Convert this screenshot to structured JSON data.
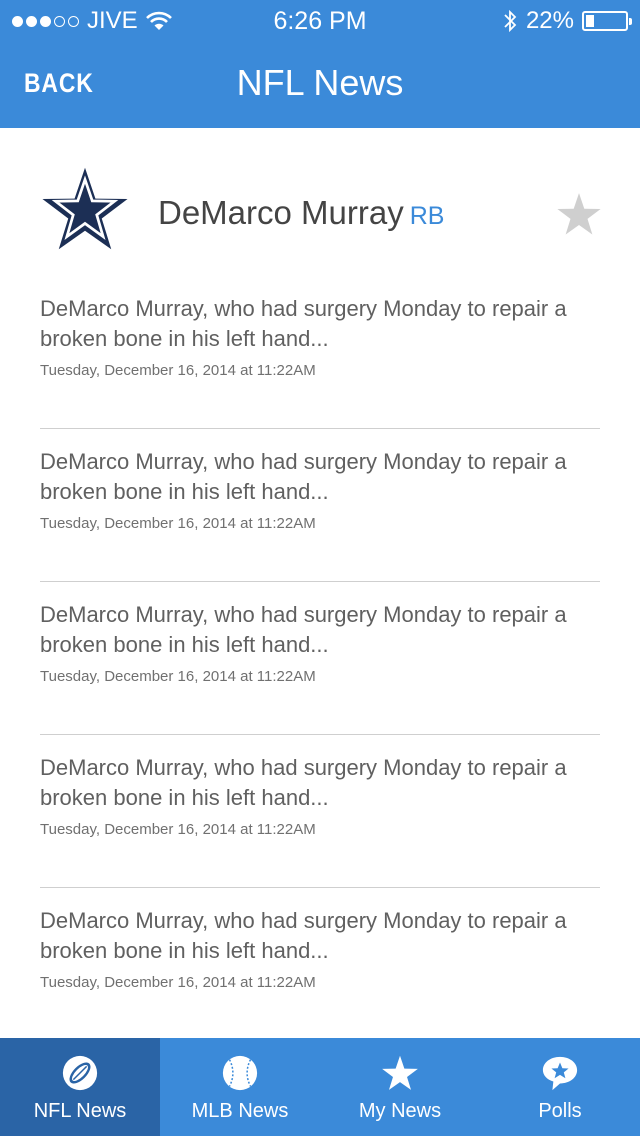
{
  "status_bar": {
    "carrier": "JIVE",
    "time": "6:26 PM",
    "battery": "22%",
    "battery_level": 0.22
  },
  "nav": {
    "back_label": "BACK",
    "title": "NFL News"
  },
  "player": {
    "name": "DeMarco Murray",
    "position": "RB",
    "team_icon": "cowboys-star-icon"
  },
  "news": [
    {
      "text": "DeMarco Murray, who had surgery Monday to repair a broken bone in his left hand...",
      "time": "Tuesday, December 16, 2014 at 11:22AM"
    },
    {
      "text": "DeMarco Murray, who had surgery Monday to repair a broken bone in his left hand...",
      "time": "Tuesday, December 16, 2014 at 11:22AM"
    },
    {
      "text": "DeMarco Murray, who had surgery Monday to repair a broken bone in his left hand...",
      "time": "Tuesday, December 16, 2014 at 11:22AM"
    },
    {
      "text": "DeMarco Murray, who had surgery Monday to repair a broken bone in his left hand...",
      "time": "Tuesday, December 16, 2014 at 11:22AM"
    },
    {
      "text": "DeMarco Murray, who had surgery Monday to repair a broken bone in his left hand...",
      "time": "Tuesday, December 16, 2014 at 11:22AM"
    }
  ],
  "tabs": [
    {
      "label": "NFL News",
      "icon": "football-icon",
      "active": true
    },
    {
      "label": "MLB News",
      "icon": "baseball-icon",
      "active": false
    },
    {
      "label": "My News",
      "icon": "star-icon",
      "active": false
    },
    {
      "label": "Polls",
      "icon": "chat-star-icon",
      "active": false
    }
  ],
  "colors": {
    "primary": "#3b8ad9",
    "active_tab": "#2a64a6",
    "team_navy": "#1c2f55"
  }
}
